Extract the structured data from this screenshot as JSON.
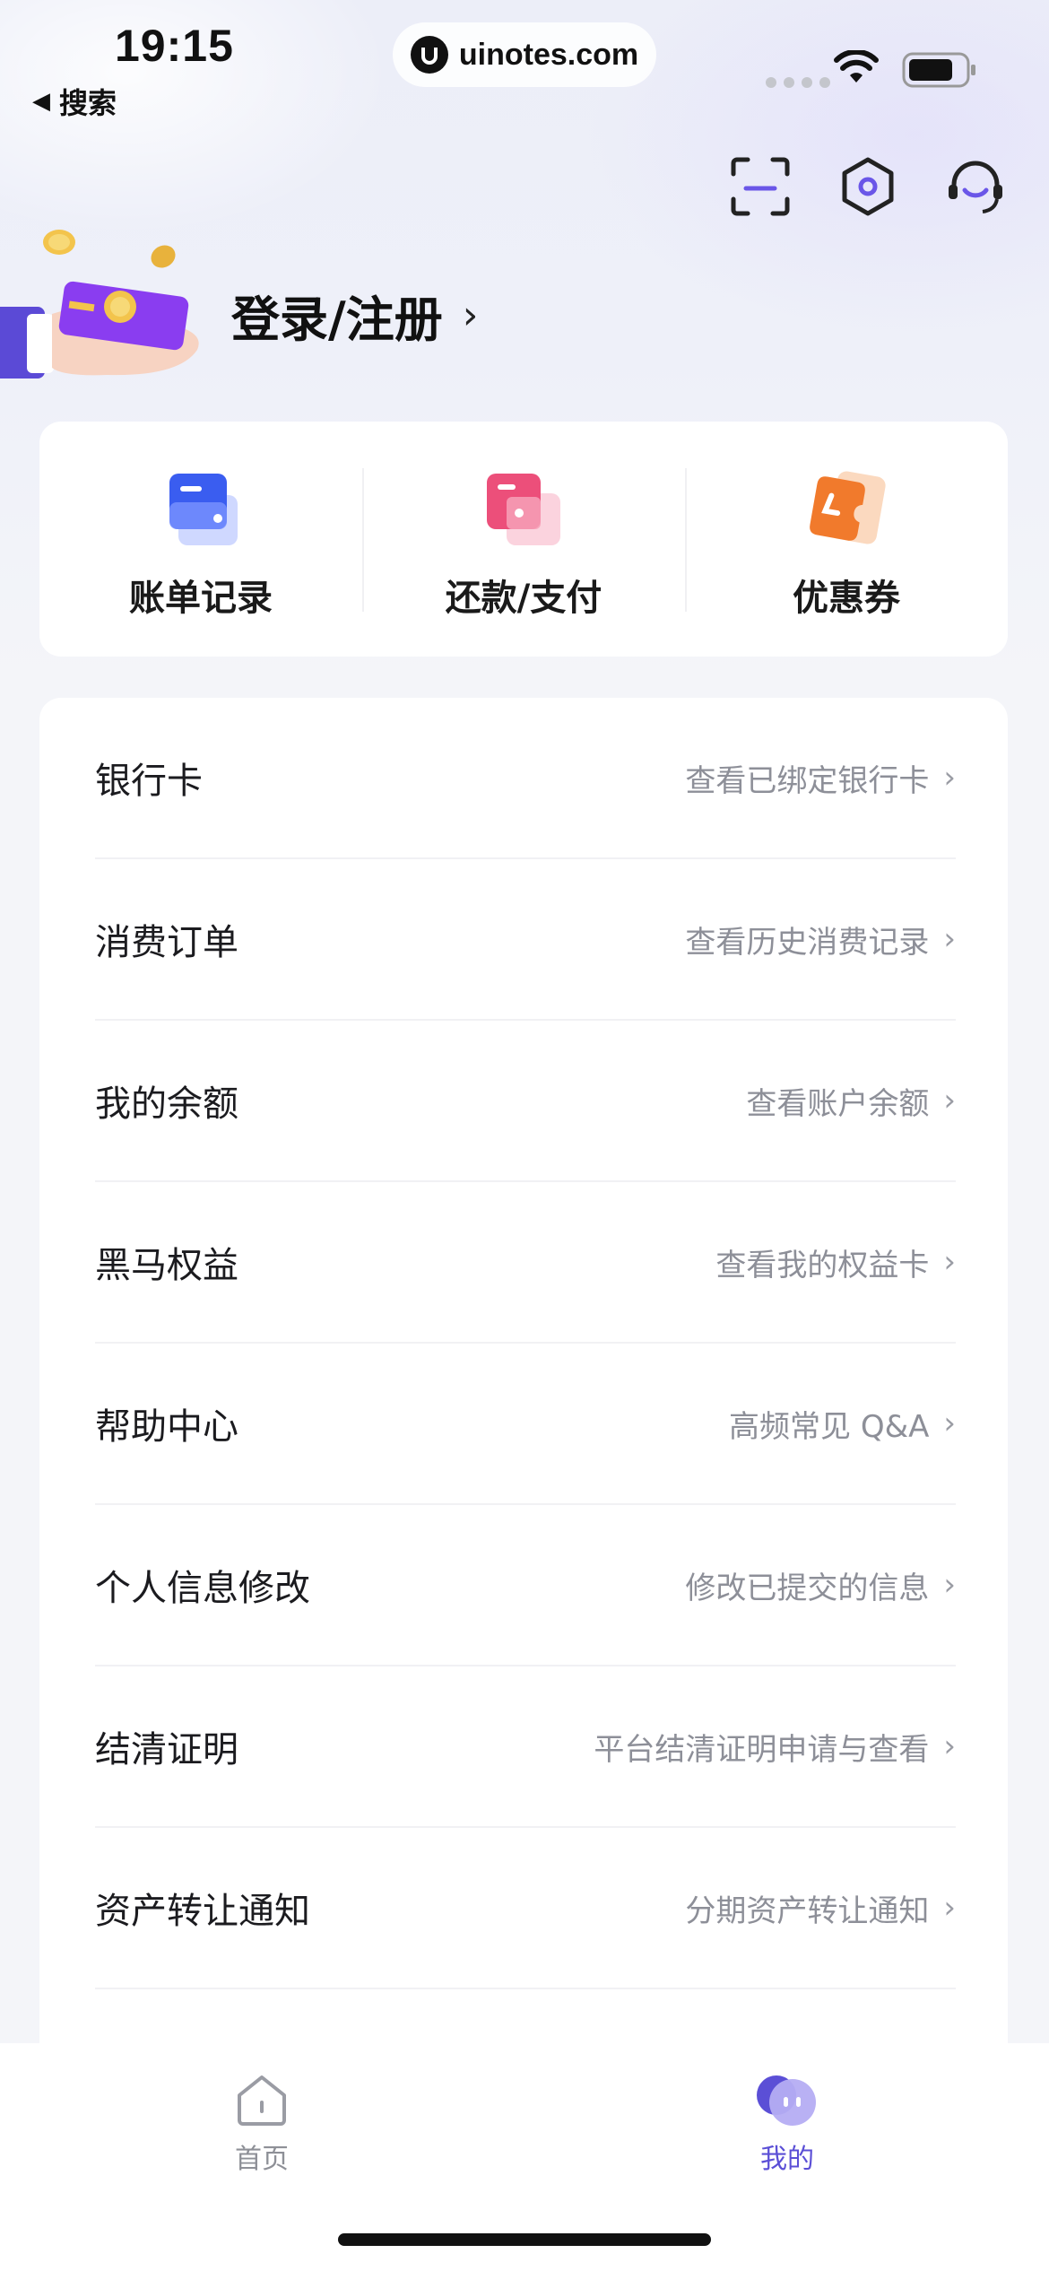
{
  "status_bar": {
    "time": "19:15",
    "back_label": "搜索",
    "url": "uinotes.com"
  },
  "header": {
    "icons": [
      "scan-icon",
      "settings-icon",
      "customer-service-icon"
    ],
    "login_label": "登录/注册",
    "chevron": "›"
  },
  "quick_actions": [
    {
      "label": "账单记录",
      "icon": "bill-record-icon",
      "color": "#3a63f0"
    },
    {
      "label": "还款/支付",
      "icon": "repay-pay-icon",
      "color": "#ec4f7a"
    },
    {
      "label": "优惠券",
      "icon": "coupon-icon",
      "color": "#f17a2c"
    }
  ],
  "menu": [
    {
      "title": "银行卡",
      "sub": "查看已绑定银行卡"
    },
    {
      "title": "消费订单",
      "sub": "查看历史消费记录"
    },
    {
      "title": "我的余额",
      "sub": "查看账户余额"
    },
    {
      "title": "黑马权益",
      "sub": "查看我的权益卡"
    },
    {
      "title": "帮助中心",
      "sub": "高频常见 Q&A"
    },
    {
      "title": "个人信息修改",
      "sub": "修改已提交的信息"
    },
    {
      "title": "结清证明",
      "sub": "平台结清证明申请与查看"
    },
    {
      "title": "资产转让通知",
      "sub": "分期资产转让通知"
    }
  ],
  "tabbar": {
    "items": [
      {
        "label": "首页",
        "icon": "home-icon",
        "active": false
      },
      {
        "label": "我的",
        "icon": "profile-icon",
        "active": true
      }
    ]
  },
  "colors": {
    "accent": "#5b4fd6",
    "text_primary": "#1b1b1f",
    "text_secondary": "#8d8f98"
  }
}
